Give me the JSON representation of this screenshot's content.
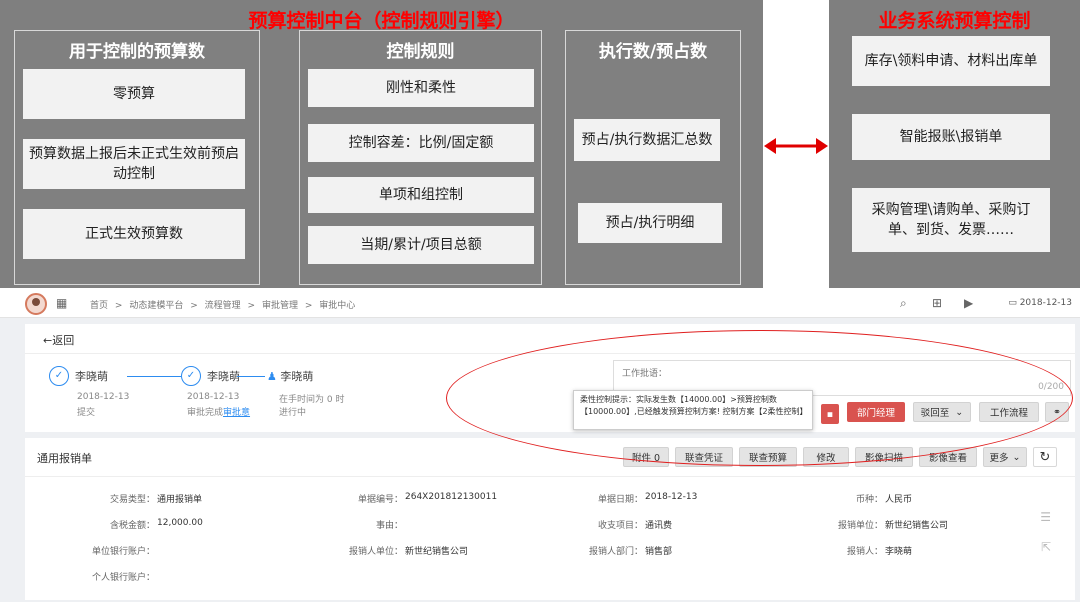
{
  "diagram": {
    "main_title": "预算控制中台（控制规则引擎）",
    "right_title": "业务系统预算控制",
    "col1": {
      "title": "用于控制的预算数",
      "items": [
        "零预算",
        "预算数据上报后未正式生效前预启动控制",
        "正式生效预算数"
      ]
    },
    "col2": {
      "title": "控制规则",
      "items": [
        "刚性和柔性",
        "控制容差：比例/固定额",
        "单项和组控制",
        "当期/累计/项目总额"
      ]
    },
    "col3": {
      "title": "执行数/预占数",
      "items": [
        "预占/执行数据汇总数",
        "预占/执行明细"
      ]
    },
    "col4": {
      "items": [
        "库存\\领料申请、材料出库单",
        "智能报账\\报销单",
        "采购管理\\请购单、采购订单、到货、发票……"
      ]
    },
    "arrow_color": "#e00000"
  },
  "topbar": {
    "breadcrumbs": [
      "首页",
      ">",
      "动态建模平台",
      ">",
      "流程管理",
      ">",
      "审批管理",
      ">",
      "审批中心"
    ],
    "date": "2018-12-13"
  },
  "back": "←返回",
  "flow": {
    "nodes": [
      {
        "name": "李晓萌",
        "date": "2018-12-13",
        "status": "提交"
      },
      {
        "name": "李晓萌",
        "date": "2018-12-13",
        "status_prefix": "审批完成",
        "status_link": "审批意"
      },
      {
        "name": "李晓萌",
        "date": "在手时间为 0 时",
        "status": "进行中"
      }
    ]
  },
  "comment": {
    "label": "工作批语：",
    "count": "0/200"
  },
  "tooltip": {
    "text": "柔性控制提示：实际发生数【14000.00】>预算控制数【10000.00】,已经触发预算控制方案! 控制方案【2柔性控制】"
  },
  "actions": {
    "dept": "部门经理",
    "reject": "驳回至",
    "workflow": "工作流程"
  },
  "form": {
    "title": "通用报销单",
    "buttons": [
      "附件 0",
      "联查凭证",
      "联查预算",
      "修改",
      "影像扫描",
      "影像查看",
      "更多"
    ],
    "fields": [
      {
        "label": "交易类型：",
        "value": "通用报销单"
      },
      {
        "label": "单据编号：",
        "value": "264X201812130011"
      },
      {
        "label": "单据日期：",
        "value": "2018-12-13"
      },
      {
        "label": "币种：",
        "value": "人民币"
      },
      {
        "label": "含税金额：",
        "value": "12,000.00"
      },
      {
        "label": "事由：",
        "value": ""
      },
      {
        "label": "收支项目：",
        "value": "通讯费"
      },
      {
        "label": "报销单位：",
        "value": "新世纪销售公司"
      },
      {
        "label": "单位银行账户：",
        "value": ""
      },
      {
        "label": "报销人单位：",
        "value": "新世纪销售公司"
      },
      {
        "label": "报销人部门：",
        "value": "销售部"
      },
      {
        "label": "报销人：",
        "value": "李晓萌"
      },
      {
        "label": "个人银行账户：",
        "value": ""
      }
    ]
  }
}
